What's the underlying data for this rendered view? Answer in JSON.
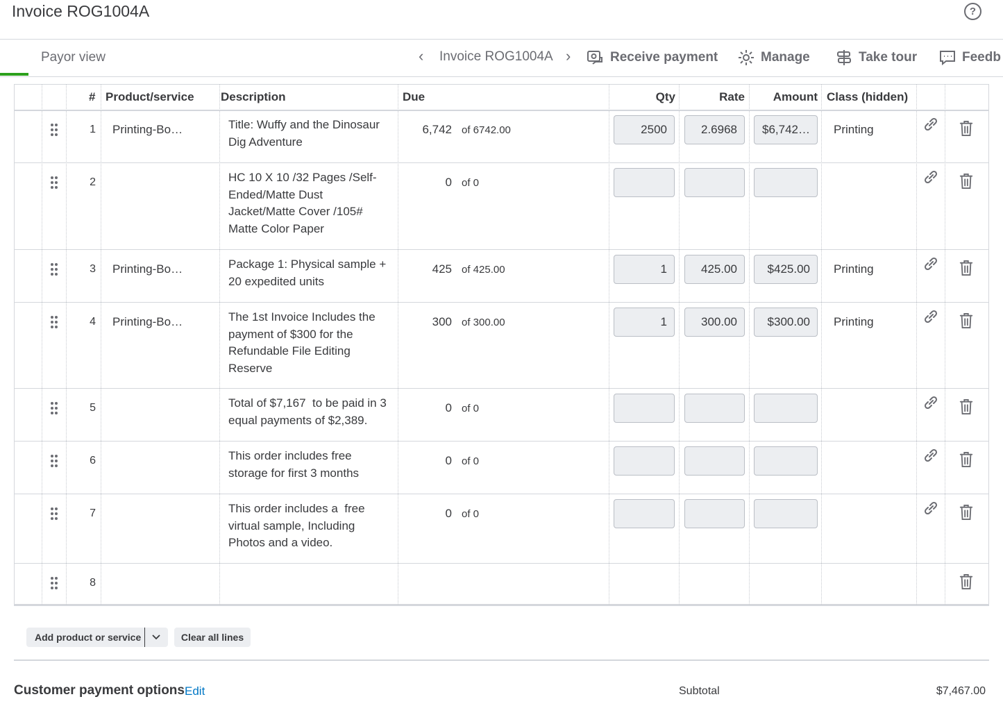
{
  "title": "Invoice ROG1004A",
  "toolbar": {
    "payor_view": "Payor view",
    "invoice_nav": "Invoice ROG1004A",
    "receive_payment": "Receive payment",
    "manage": "Manage",
    "take_tour": "Take tour",
    "feedback": "Feedb"
  },
  "table": {
    "headers": {
      "num": "#",
      "product": "Product/service",
      "description": "Description",
      "due": "Due",
      "qty": "Qty",
      "rate": "Rate",
      "amount": "Amount",
      "class": "Class (hidden)"
    },
    "rows": [
      {
        "num": "1",
        "product": "Printing-Bo…",
        "desc": [
          "Title: Wuffy and the Dinosaur",
          "Dig Adventure"
        ],
        "due": "6,742",
        "of": "of 6742.00",
        "qty": "2500",
        "rate": "2.6968",
        "amount": "$6,742…",
        "class": "Printing"
      },
      {
        "num": "2",
        "product": "",
        "desc": [
          "HC 10 X 10 /32 Pages /Self-",
          "Ended/Matte Dust",
          "Jacket/Matte Cover /105#",
          "Matte Color Paper"
        ],
        "due": "0",
        "of": "of 0",
        "qty": "",
        "rate": "",
        "amount": "",
        "class": ""
      },
      {
        "num": "3",
        "product": "Printing-Bo…",
        "desc": [
          "Package 1: Physical sample +",
          "20 expedited units"
        ],
        "due": "425",
        "of": "of 425.00",
        "qty": "1",
        "rate": "425.00",
        "amount": "$425.00",
        "class": "Printing"
      },
      {
        "num": "4",
        "product": "Printing-Bo…",
        "desc": [
          "The 1st Invoice Includes the",
          "payment of $300 for the",
          "Refundable File Editing",
          "Reserve"
        ],
        "due": "300",
        "of": "of 300.00",
        "qty": "1",
        "rate": "300.00",
        "amount": "$300.00",
        "class": "Printing"
      },
      {
        "num": "5",
        "product": "",
        "desc": [
          "Total of $7,167  to be paid in 3",
          "equal payments of $2,389."
        ],
        "due": "0",
        "of": "of 0",
        "qty": "",
        "rate": "",
        "amount": "",
        "class": ""
      },
      {
        "num": "6",
        "product": "",
        "desc": [
          "This order includes free",
          "storage for first 3 months"
        ],
        "due": "0",
        "of": "of 0",
        "qty": "",
        "rate": "",
        "amount": "",
        "class": ""
      },
      {
        "num": "7",
        "product": "",
        "desc": [
          "This order includes a  free",
          "virtual sample, Including",
          "Photos and a video."
        ],
        "due": "0",
        "of": "of 0",
        "qty": "",
        "rate": "",
        "amount": "",
        "class": ""
      },
      {
        "num": "8",
        "product": "",
        "desc": [],
        "due": "",
        "of": "",
        "qty": "",
        "rate": "",
        "amount": "",
        "class": ""
      }
    ]
  },
  "actions": {
    "add_product": "Add product or service",
    "clear_lines": "Clear all lines"
  },
  "footer": {
    "payment_options": "Customer payment options",
    "edit": "Edit",
    "subtotal_label": "Subtotal",
    "subtotal_value": "$7,467.00"
  },
  "colors": {
    "accent_green": "#2ca01c",
    "link_blue": "#0077c5",
    "input_bg": "#eceef1"
  }
}
